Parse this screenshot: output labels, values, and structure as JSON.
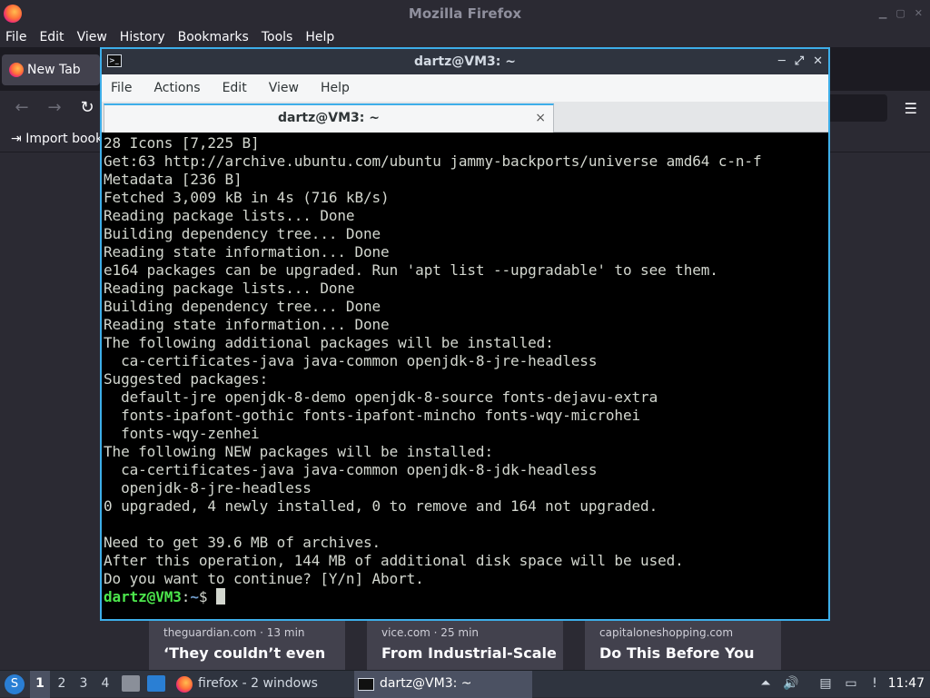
{
  "firefox": {
    "window_title": "Mozilla Firefox",
    "menu": [
      "File",
      "Edit",
      "View",
      "History",
      "Bookmarks",
      "Tools",
      "Help"
    ],
    "tab_label": "New Tab",
    "import_bookmarks": "Import book",
    "stories": [
      {
        "source": "theguardian.com · 13 min",
        "headline": "‘They couldn’t even"
      },
      {
        "source": "vice.com · 25 min",
        "headline": "From Industrial-Scale"
      },
      {
        "source": "capitaloneshopping.com",
        "headline": "Do This Before You"
      }
    ]
  },
  "terminal": {
    "window_title": "dartz@VM3: ~",
    "menu": [
      "File",
      "Actions",
      "Edit",
      "View",
      "Help"
    ],
    "tab_label": "dartz@VM3: ~",
    "tab_close": "×",
    "lines": [
      "28 Icons [7,225 B]",
      "Get:63 http://archive.ubuntu.com/ubuntu jammy-backports/universe amd64 c-n-f",
      "Metadata [236 B]",
      "Fetched 3,009 kB in 4s (716 kB/s)",
      "Reading package lists... Done",
      "Building dependency tree... Done",
      "Reading state information... Done",
      "e164 packages can be upgraded. Run 'apt list --upgradable' to see them.",
      "Reading package lists... Done",
      "Building dependency tree... Done",
      "Reading state information... Done",
      "The following additional packages will be installed:",
      "  ca-certificates-java java-common openjdk-8-jre-headless",
      "Suggested packages:",
      "  default-jre openjdk-8-demo openjdk-8-source fonts-dejavu-extra",
      "  fonts-ipafont-gothic fonts-ipafont-mincho fonts-wqy-microhei",
      "  fonts-wqy-zenhei",
      "The following NEW packages will be installed:",
      "  ca-certificates-java java-common openjdk-8-jdk-headless",
      "  openjdk-8-jre-headless",
      "0 upgraded, 4 newly installed, 0 to remove and 164 not upgraded.",
      "",
      "Need to get 39.6 MB of archives.",
      "After this operation, 144 MB of additional disk space will be used.",
      "Do you want to continue? [Y/n] Abort."
    ],
    "prompt": {
      "user_host": "dartz@VM3",
      "colon": ":",
      "path": "~",
      "symbol": "$ "
    }
  },
  "taskbar": {
    "workspaces": [
      "1",
      "2",
      "3",
      "4"
    ],
    "tasks": [
      {
        "label": "firefox - 2 windows",
        "icon": "firefox-icon"
      },
      {
        "label": "dartz@VM3: ~",
        "icon": "terminal-icon"
      }
    ],
    "clock": "11:47"
  },
  "colors": {
    "accent": "#3daee9",
    "prompt_user": "#4ce64c",
    "prompt_path": "#729fcf"
  }
}
